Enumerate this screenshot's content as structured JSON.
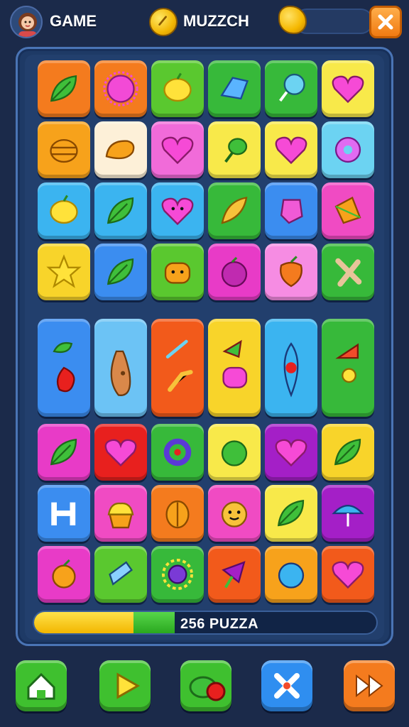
{
  "header": {
    "player_label": "GAME",
    "coin_label": "MUZZCH",
    "icons": [
      "avatar",
      "coin-icon",
      "gem-icon",
      "close-icon"
    ]
  },
  "board": {
    "rows_top": [
      [
        {
          "name": "tile-leaf-stick",
          "bg": "#f47b1e",
          "icon": "leaf"
        },
        {
          "name": "tile-urchin",
          "bg": "#f47b1e",
          "icon": "spiky-ball"
        },
        {
          "name": "tile-lemon",
          "bg": "#5ac82f",
          "icon": "lemon"
        },
        {
          "name": "tile-blue-gem",
          "bg": "#37b93a",
          "icon": "blue-gem"
        },
        {
          "name": "tile-lollipop",
          "bg": "#37b93a",
          "icon": "lollipop"
        },
        {
          "name": "tile-heart-pink",
          "bg": "#f8e94a",
          "icon": "heart"
        }
      ],
      [
        {
          "name": "tile-jar",
          "bg": "#f7a21b",
          "icon": "jar"
        },
        {
          "name": "tile-bread",
          "bg": "#fdf0d8",
          "icon": "bread"
        },
        {
          "name": "tile-heart-orange",
          "bg": "#f16bd9",
          "icon": "heart"
        },
        {
          "name": "tile-pepper",
          "bg": "#f8e94a",
          "icon": "pepper"
        },
        {
          "name": "tile-heart-magenta",
          "bg": "#f8e94a",
          "icon": "heart"
        },
        {
          "name": "tile-flower",
          "bg": "#6cd3f2",
          "icon": "flower"
        }
      ],
      [
        {
          "name": "tile-lemon-slice",
          "bg": "#3bb4f0",
          "icon": "lemon"
        },
        {
          "name": "tile-leaf-green",
          "bg": "#3bb4f0",
          "icon": "leaf"
        },
        {
          "name": "tile-heart-face",
          "bg": "#3bb4f0",
          "icon": "heart-face"
        },
        {
          "name": "tile-feather",
          "bg": "#37b93a",
          "icon": "feather"
        },
        {
          "name": "tile-pink-gem",
          "bg": "#3b8df0",
          "icon": "pink-gem"
        },
        {
          "name": "tile-kite",
          "bg": "#f04bc3",
          "icon": "kite"
        }
      ],
      [
        {
          "name": "tile-star",
          "bg": "#f8d42a",
          "icon": "star"
        },
        {
          "name": "tile-yellow-leaf",
          "bg": "#3b8df0",
          "icon": "leaf"
        },
        {
          "name": "tile-muffin-face",
          "bg": "#5ac82f",
          "icon": "muffin"
        },
        {
          "name": "tile-berry",
          "bg": "#e83bc7",
          "icon": "berry"
        },
        {
          "name": "tile-orange-fruit",
          "bg": "#f68ce3",
          "icon": "fruit"
        },
        {
          "name": "tile-cross",
          "bg": "#37b93a",
          "icon": "cross"
        }
      ]
    ],
    "tall_row": [
      {
        "name": "tile-tall-leaf-drop",
        "bg": "#3b8df0",
        "icon": "leaf-drop"
      },
      {
        "name": "tile-tall-sack",
        "bg": "#6cc3f5",
        "icon": "sack"
      },
      {
        "name": "tile-tall-birds",
        "bg": "#f25a1b",
        "icon": "bird"
      },
      {
        "name": "tile-tall-fruits",
        "bg": "#f8d42a",
        "icon": "fruits"
      },
      {
        "name": "tile-tall-seed",
        "bg": "#3bb4f0",
        "icon": "seed"
      },
      {
        "name": "tile-tall-triangle",
        "bg": "#37b93a",
        "icon": "triangle"
      }
    ],
    "rows_bottom": [
      [
        {
          "name": "tile-green-leaf",
          "bg": "#e83bc7",
          "icon": "leaf"
        },
        {
          "name": "tile-pink-heart",
          "bg": "#e8201e",
          "icon": "heart"
        },
        {
          "name": "tile-ring",
          "bg": "#37b93a",
          "icon": "ring"
        },
        {
          "name": "tile-lime",
          "bg": "#f8e94a",
          "icon": "lime"
        },
        {
          "name": "tile-pink-heart-2",
          "bg": "#a41fc7",
          "icon": "heart"
        },
        {
          "name": "tile-blue-leaf",
          "bg": "#f8d42a",
          "icon": "leaf"
        }
      ],
      [
        {
          "name": "tile-letter",
          "bg": "#3b8df0",
          "icon": "letter"
        },
        {
          "name": "tile-cupcake",
          "bg": "#f04bc3",
          "icon": "cupcake"
        },
        {
          "name": "tile-nut",
          "bg": "#f47b1e",
          "icon": "nut"
        },
        {
          "name": "tile-smiley",
          "bg": "#f04bc3",
          "icon": "smiley"
        },
        {
          "name": "tile-green-leaf-2",
          "bg": "#f8e94a",
          "icon": "leaf"
        },
        {
          "name": "tile-umbrella",
          "bg": "#a41fc7",
          "icon": "umbrella"
        }
      ],
      [
        {
          "name": "tile-orange",
          "bg": "#e83bc7",
          "icon": "orange"
        },
        {
          "name": "tile-crystal",
          "bg": "#5ac82f",
          "icon": "crystal"
        },
        {
          "name": "tile-sun",
          "bg": "#37b93a",
          "icon": "sun"
        },
        {
          "name": "tile-dart",
          "bg": "#f25a1b",
          "icon": "dart"
        },
        {
          "name": "tile-blue-ball",
          "bg": "#f7a21b",
          "icon": "ball"
        },
        {
          "name": "tile-green-heart",
          "bg": "#f25a1b",
          "icon": "heart"
        }
      ]
    ]
  },
  "progress": {
    "label": "256 PUZZA",
    "yellow_fraction": 0.29,
    "green_fraction": 0.12,
    "colors": {
      "yellow": "#f2c300",
      "green": "#2aa81f"
    }
  },
  "nav": [
    {
      "name": "home-button",
      "icon": "home-icon",
      "bg": "#3fc02f"
    },
    {
      "name": "play-button",
      "icon": "play-icon",
      "bg": "#3fc02f"
    },
    {
      "name": "powerup-button",
      "icon": "fruit-bomb-icon",
      "bg": "#3fc02f"
    },
    {
      "name": "tools-button",
      "icon": "tools-icon",
      "bg": "#2f8ef0"
    },
    {
      "name": "fast-forward-button",
      "icon": "fast-forward-icon",
      "bg": "#f47b1e"
    }
  ]
}
